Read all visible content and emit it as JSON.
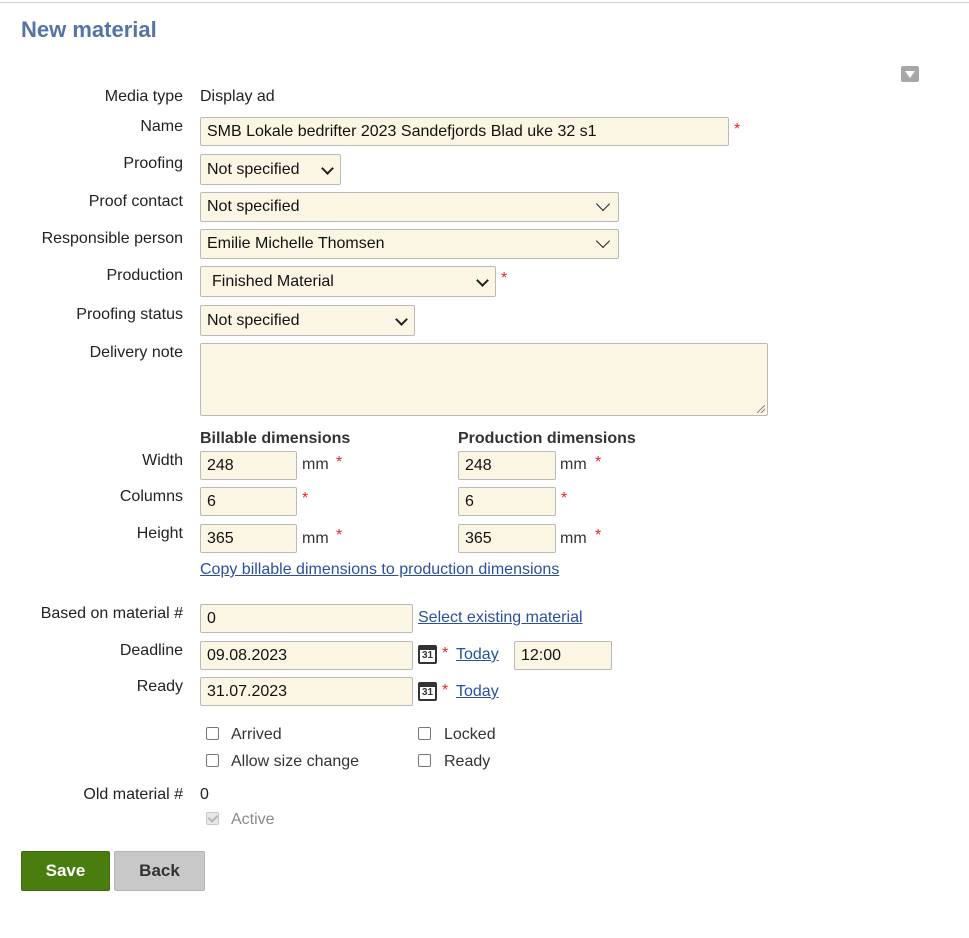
{
  "page": {
    "title": "New material"
  },
  "form": {
    "media_type": {
      "label": "Media type",
      "value": "Display ad"
    },
    "name": {
      "label": "Name",
      "value": "SMB Lokale bedrifter 2023 Sandefjords Blad uke 32 s1",
      "required": "*"
    },
    "proofing": {
      "label": "Proofing",
      "value": "Not specified"
    },
    "proof_contact": {
      "label": "Proof contact",
      "value": "Not specified"
    },
    "responsible_person": {
      "label": "Responsible person",
      "value": "Emilie Michelle Thomsen"
    },
    "production": {
      "label": "Production",
      "value": "Finished Material",
      "required": "*"
    },
    "proofing_status": {
      "label": "Proofing status",
      "value": "Not specified"
    },
    "delivery_note": {
      "label": "Delivery note",
      "value": ""
    },
    "dimensions": {
      "billable_header": "Billable dimensions",
      "production_header": "Production dimensions",
      "width": {
        "label": "Width",
        "billable": "248",
        "production": "248",
        "unit": "mm"
      },
      "columns": {
        "label": "Columns",
        "billable": "6",
        "production": "6"
      },
      "height": {
        "label": "Height",
        "billable": "365",
        "production": "365",
        "unit": "mm"
      },
      "required": "*",
      "copy_link": "Copy billable dimensions to production dimensions"
    },
    "based_on": {
      "label": "Based on material #",
      "value": "0",
      "link": "Select existing material"
    },
    "deadline": {
      "label": "Deadline",
      "date": "09.08.2023",
      "time": "12:00",
      "today": "Today",
      "required": "*"
    },
    "ready": {
      "label": "Ready",
      "date": "31.07.2023",
      "today": "Today",
      "required": "*"
    },
    "calendar_icon_text": "31",
    "checkboxes": {
      "arrived": {
        "label": "Arrived",
        "checked": false
      },
      "locked": {
        "label": "Locked",
        "checked": false
      },
      "allow_size_change": {
        "label": "Allow size change",
        "checked": false
      },
      "ready": {
        "label": "Ready",
        "checked": false
      }
    },
    "old_material": {
      "label": "Old material #",
      "value": "0"
    },
    "active": {
      "label": "Active",
      "checked": true,
      "disabled": true
    }
  },
  "buttons": {
    "save": "Save",
    "back": "Back"
  },
  "colors": {
    "title": "#5673a6",
    "input_bg": "#fbf6e3",
    "required": "#e0262c",
    "link": "#2a4fa0",
    "save_bg": "#4a7d10",
    "back_bg": "#c8c8c8"
  },
  "icons": {
    "collapse": "triangle-down-icon",
    "calendar": "calendar-icon",
    "dropdown": "chevron-down-icon"
  }
}
